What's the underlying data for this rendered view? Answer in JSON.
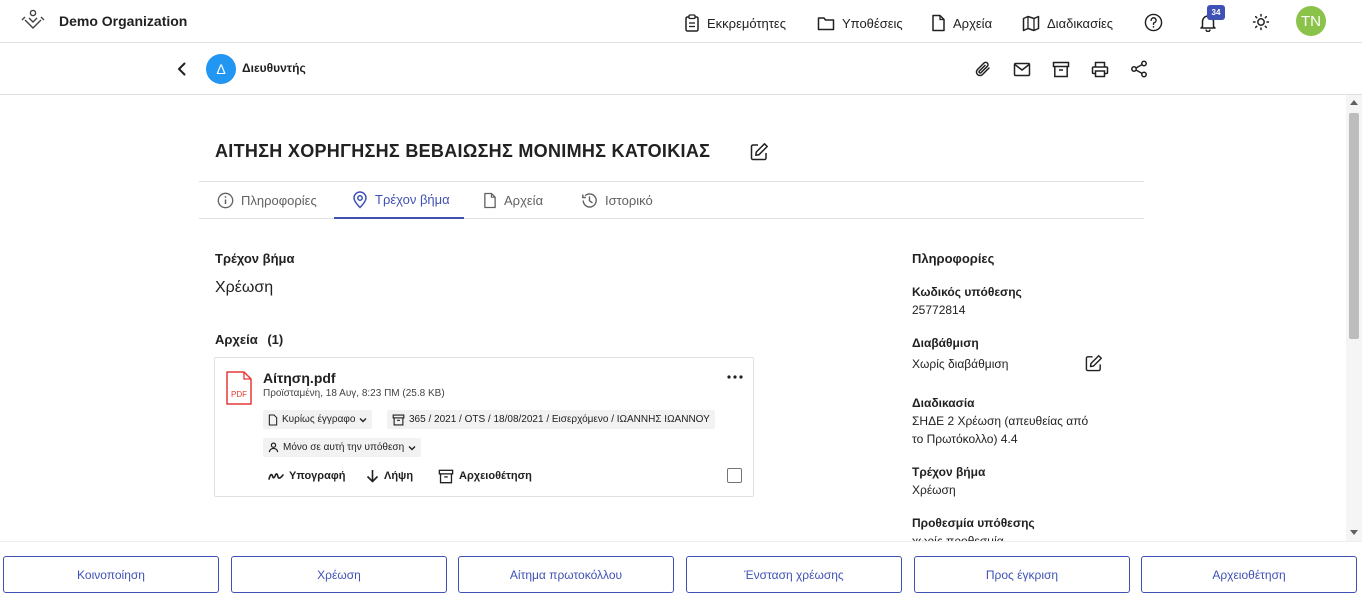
{
  "header": {
    "org_name": "Demo Organization",
    "nav": [
      {
        "label": "Εκκρεμότητες",
        "icon": "clipboard-icon"
      },
      {
        "label": "Υποθέσεις",
        "icon": "folder-icon"
      },
      {
        "label": "Αρχεία",
        "icon": "file-icon"
      },
      {
        "label": "Διαδικασίες",
        "icon": "map-icon"
      }
    ],
    "notification_count": "34",
    "user_initials": "TN",
    "colors": {
      "user_avatar": "#8bc34a",
      "badge": "#3f51b5"
    }
  },
  "subheader": {
    "role_initial": "Δ",
    "role_name": "Διευθυντής",
    "actions": [
      "attachment-icon",
      "mail-icon",
      "archive-icon",
      "print-icon",
      "share-icon"
    ]
  },
  "case": {
    "title": "ΑΙΤΗΣΗ ΧΟΡΗΓΗΣΗΣ ΒΕΒΑΙΩΣΗΣ ΜΟΝΙΜΗΣ ΚΑΤΟΙΚΙΑΣ",
    "tabs": [
      {
        "label": "Πληροφορίες",
        "icon": "info-icon",
        "active": false
      },
      {
        "label": "Τρέχον βήμα",
        "icon": "location-pin-icon",
        "active": true
      },
      {
        "label": "Αρχεία",
        "icon": "file-icon",
        "active": false
      },
      {
        "label": "Ιστορικό",
        "icon": "history-icon",
        "active": false
      }
    ],
    "accent_color": "#3f51b5"
  },
  "current_step": {
    "heading": "Τρέχον βήμα",
    "value": "Χρέωση",
    "files_heading": "Αρχεία",
    "files_count": "(1)"
  },
  "file": {
    "name": "Αίτηση.pdf",
    "meta": "Προϊσταμένη, 18 Αυγ, 8:23 ΠΜ (25.8 KB)",
    "type_label": "PDF",
    "doc_type": "Κυρίως έγγραφο",
    "protocol": "365 / 2021 / OTS / 18/08/2021 / Εισερχόμενο / ΙΩΑΝΝΗΣ ΙΩΑΝΝΟΥ",
    "scope": "Μόνο σε αυτή την υπόθεση",
    "actions": {
      "sign": "Υπογραφή",
      "download": "Λήψη",
      "archive": "Αρχειοθέτηση"
    }
  },
  "info_panel": {
    "heading": "Πληροφορίες",
    "case_code_label": "Κωδικός υπόθεσης",
    "case_code": "25772814",
    "classification_label": "Διαβάθμιση",
    "classification": "Χωρίς διαβάθμιση",
    "procedure_label": "Διαδικασία",
    "procedure_line1": "ΣΗΔΕ 2 Χρέωση (απευθείας από",
    "procedure_line2": "το Πρωτόκολλο) 4.4",
    "step_label": "Τρέχον βήμα",
    "step": "Χρέωση",
    "deadline_label": "Προθεσμία υπόθεσης",
    "deadline": "χωρίς προθεσμία"
  },
  "bottom_actions": [
    "Κοινοποίηση",
    "Χρέωση",
    "Αίτημα πρωτοκόλλου",
    "Ένσταση χρέωσης",
    "Προς έγκριση",
    "Αρχειοθέτηση"
  ]
}
